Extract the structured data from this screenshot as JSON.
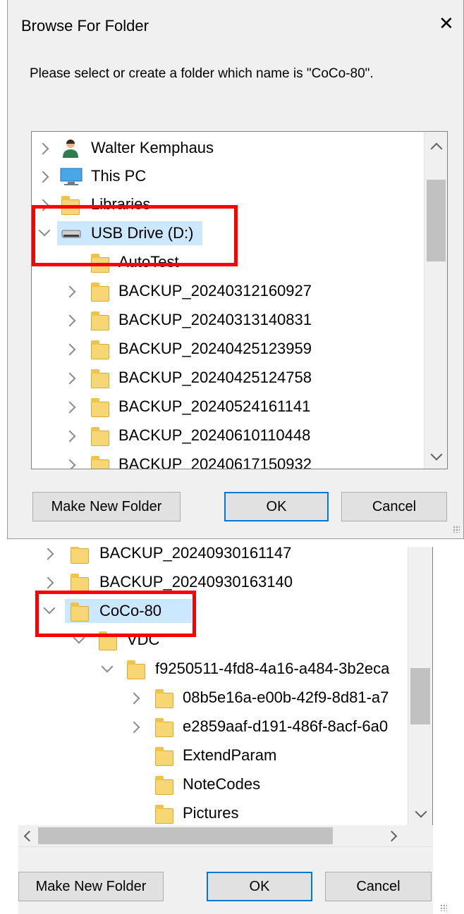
{
  "dialog1": {
    "title": "Browse For Folder",
    "close": "✕",
    "prompt": "Please select or create a folder which name is \"CoCo-80\".",
    "tree": [
      {
        "label": "Walter Kemphaus",
        "icon": "user-icon"
      },
      {
        "label": "This PC",
        "icon": "computer-icon"
      },
      {
        "label": "Libraries",
        "icon": "libraries-icon"
      },
      {
        "label": "USB Drive (D:)",
        "icon": "drive-icon"
      },
      {
        "label": "AutoTest",
        "icon": "folder-icon"
      },
      {
        "label": "BACKUP_20240312160927",
        "icon": "folder-icon"
      },
      {
        "label": "BACKUP_20240313140831",
        "icon": "folder-icon"
      },
      {
        "label": "BACKUP_20240425123959",
        "icon": "folder-icon"
      },
      {
        "label": "BACKUP_20240425124758",
        "icon": "folder-icon"
      },
      {
        "label": "BACKUP_20240524161141",
        "icon": "folder-icon"
      },
      {
        "label": "BACKUP_20240610110448",
        "icon": "folder-icon"
      },
      {
        "label": "BACKUP_20240617150932",
        "icon": "folder-icon"
      }
    ],
    "buttons": {
      "new_folder": "Make New Folder",
      "ok": "OK",
      "cancel": "Cancel"
    }
  },
  "dialog2": {
    "tree": [
      {
        "label": "BACKUP_20240930161147",
        "icon": "folder-icon"
      },
      {
        "label": "BACKUP_20240930163140",
        "icon": "folder-icon"
      },
      {
        "label": "CoCo-80",
        "icon": "folder-icon"
      },
      {
        "label": "VDC",
        "icon": "folder-icon"
      },
      {
        "label": "f9250511-4fd8-4a16-a484-3b2eca",
        "icon": "folder-icon"
      },
      {
        "label": "08b5e16a-e00b-42f9-8d81-a7",
        "icon": "folder-icon"
      },
      {
        "label": "e2859aaf-d191-486f-8acf-6a0",
        "icon": "folder-icon"
      },
      {
        "label": "ExtendParam",
        "icon": "folder-icon"
      },
      {
        "label": "NoteCodes",
        "icon": "folder-icon"
      },
      {
        "label": "Pictures",
        "icon": "folder-icon"
      }
    ],
    "buttons": {
      "new_folder": "Make New Folder",
      "ok": "OK",
      "cancel": "Cancel"
    }
  },
  "colors": {
    "selection": "#cce8ff",
    "highlight_box": "#ff0000",
    "default_button_border": "#0078d7",
    "folder": "#f7d774"
  }
}
